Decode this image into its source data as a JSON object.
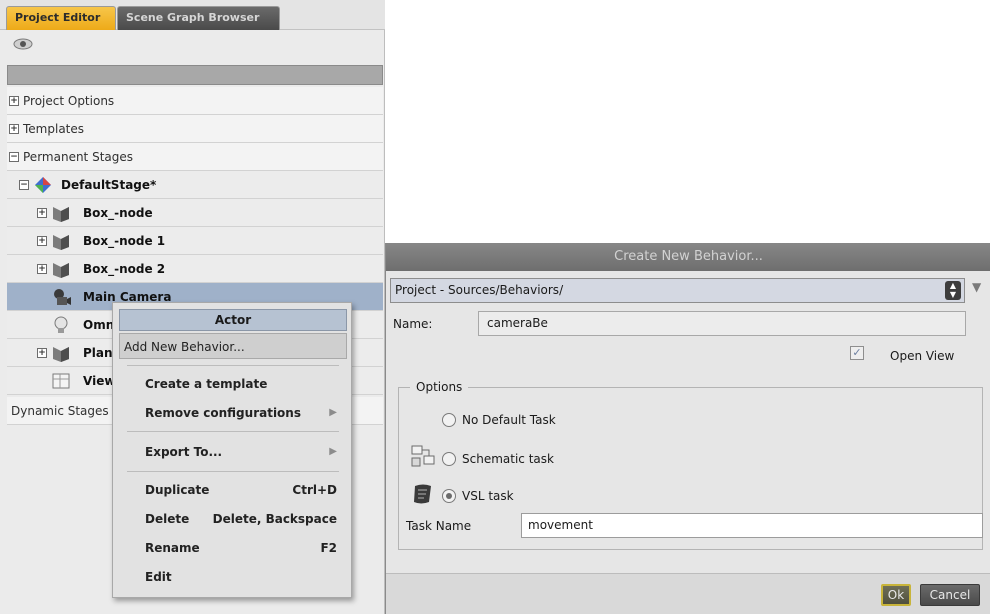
{
  "tabs": {
    "project_editor": "Project Editor",
    "scene_graph_browser": "Scene Graph Browser"
  },
  "tree": {
    "project_options": "Project Options",
    "templates": "Templates",
    "permanent_stages": "Permanent Stages",
    "default_stage": "DefaultStage*",
    "box_node": "Box_-node",
    "box_node_1": "Box_-node 1",
    "box_node_2": "Box_-node 2",
    "main_camera": "Main Camera",
    "omni_partial": "Omni",
    "plane_partial": "Plan",
    "view_partial": "View",
    "dynamic_stages": "Dynamic Stages"
  },
  "context_menu": {
    "header": "Actor",
    "add_new_behavior": "Add New Behavior...",
    "create_template": "Create a template",
    "remove_configurations": "Remove configurations",
    "export_to": "Export To...",
    "duplicate": "Duplicate",
    "duplicate_shortcut": "Ctrl+D",
    "delete": "Delete",
    "delete_shortcut": "Delete, Backspace",
    "rename": "Rename",
    "rename_shortcut": "F2",
    "edit": "Edit"
  },
  "dialog": {
    "title": "Create New Behavior...",
    "path": "Project - Sources/Behaviors/",
    "name_label": "Name:",
    "name_value": "cameraBe",
    "open_view_label": "Open View",
    "open_view_checked": true,
    "options_title": "Options",
    "no_default_task": "No Default Task",
    "schematic_task": "Schematic task",
    "vsl_task": "VSL task",
    "selected_task": "VSL task",
    "task_name_label": "Task Name",
    "task_name_value": "movement",
    "ok_label": "Ok",
    "cancel_label": "Cancel"
  },
  "colors": {
    "active_tab": "#eeaa18",
    "selection": "#9fb1c9",
    "ok_border": "#c8b43a"
  }
}
